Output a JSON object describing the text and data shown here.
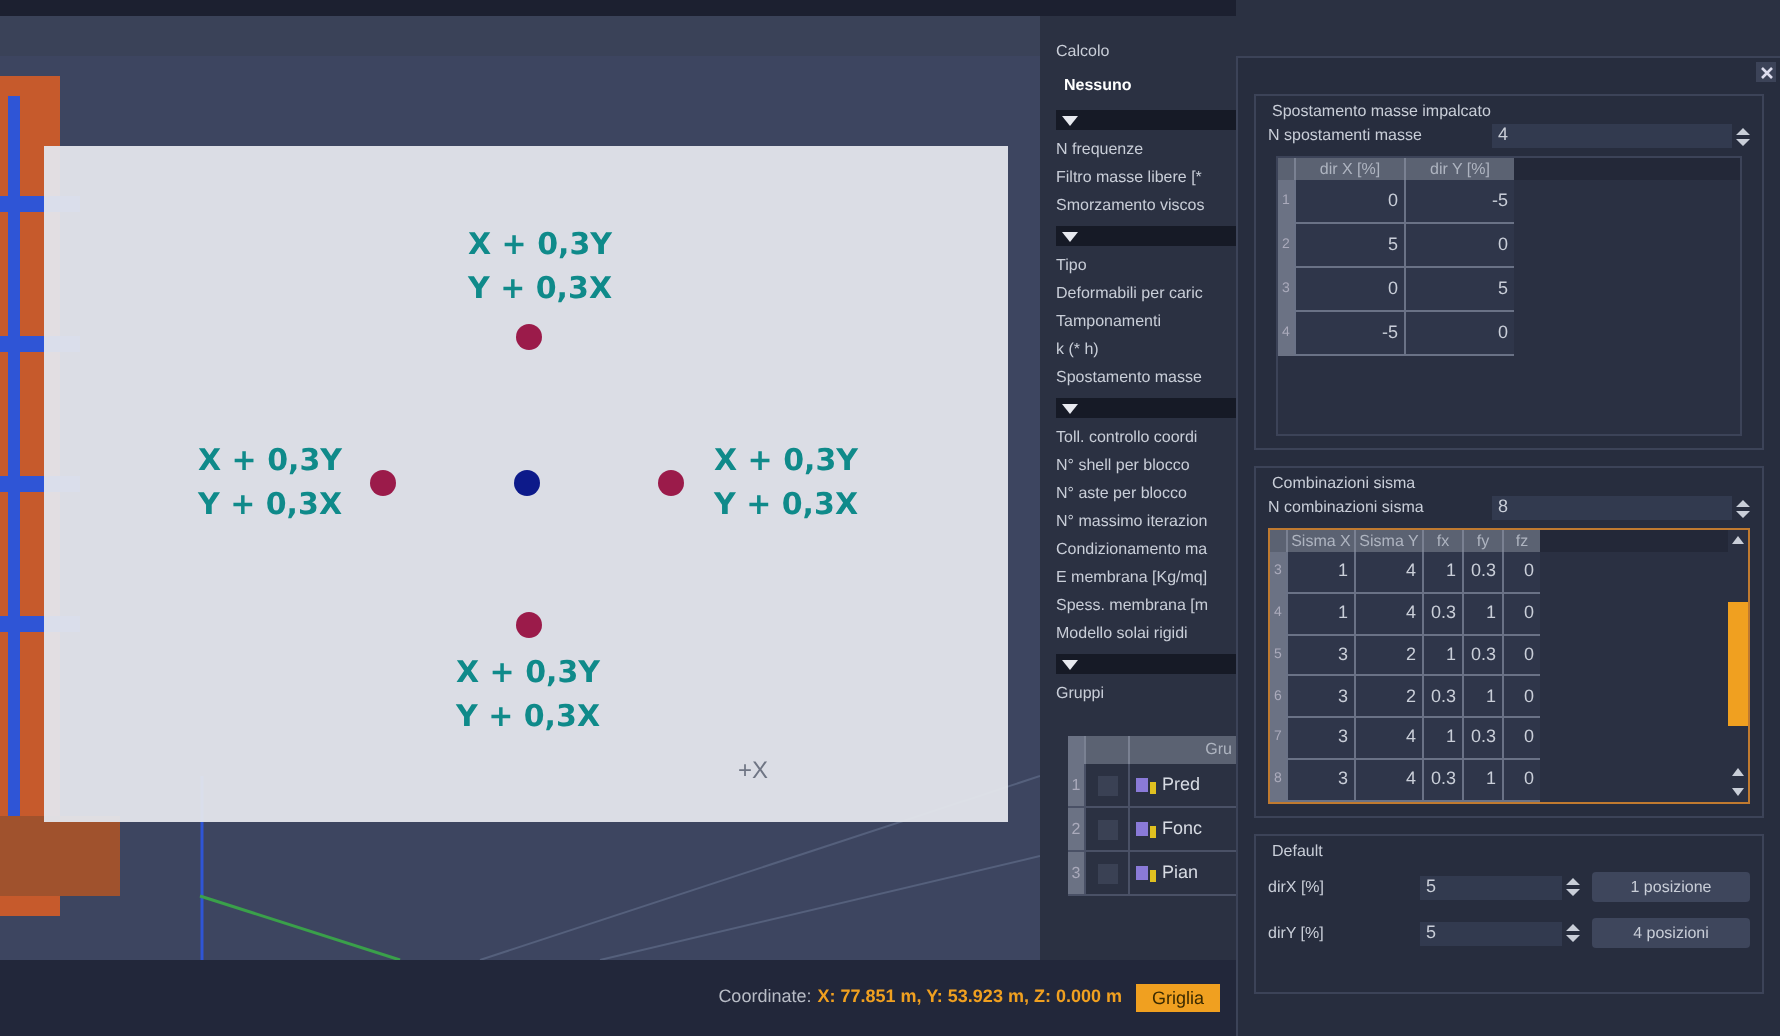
{
  "viewport": {
    "overlay": {
      "points": [
        {
          "color": "#9b1b4a",
          "label_lines": [
            "X + 0,3Y",
            "Y + 0,3X"
          ]
        },
        {
          "color": "#9b1b4a",
          "label_lines": [
            "X + 0,3Y",
            "Y + 0,3X"
          ]
        },
        {
          "color": "#0d1a8a"
        },
        {
          "color": "#9b1b4a",
          "label_lines": [
            "X + 0,3Y",
            "Y + 0,3X"
          ]
        },
        {
          "color": "#9b1b4a",
          "label_lines": [
            "X + 0,3Y",
            "Y + 0,3X"
          ]
        }
      ],
      "axis_label": "+X"
    }
  },
  "properties_panel": {
    "calcolo": {
      "label": "Calcolo",
      "value": "Nessuno"
    },
    "items": [
      {
        "kind": "section"
      },
      {
        "kind": "label",
        "text": "N frequenze"
      },
      {
        "kind": "label",
        "text": "Filtro masse libere [*"
      },
      {
        "kind": "label",
        "text": "Smorzamento viscos"
      },
      {
        "kind": "section"
      },
      {
        "kind": "label",
        "text": "Tipo"
      },
      {
        "kind": "label",
        "text": "Deformabili per caric"
      },
      {
        "kind": "label",
        "text": "Tamponamenti"
      },
      {
        "kind": "label",
        "text": "k (* h)"
      },
      {
        "kind": "label",
        "text": "Spostamento masse"
      },
      {
        "kind": "section"
      },
      {
        "kind": "label",
        "text": "Toll. controllo coordi"
      },
      {
        "kind": "label",
        "text": "N° shell per blocco"
      },
      {
        "kind": "label",
        "text": "N° aste per blocco"
      },
      {
        "kind": "label",
        "text": "N° massimo iterazion"
      },
      {
        "kind": "label",
        "text": "Condizionamento ma"
      },
      {
        "kind": "label",
        "text": "E membrana [Kg/mq]"
      },
      {
        "kind": "label",
        "text": "Spess. membrana [m"
      },
      {
        "kind": "label",
        "text": "Modello solai rigidi"
      },
      {
        "kind": "section"
      },
      {
        "kind": "label",
        "text": "Gruppi"
      }
    ],
    "groups_table": {
      "column_3": "Gru",
      "rows": [
        {
          "index": "1",
          "checked": false,
          "name": "Pred"
        },
        {
          "index": "2",
          "checked": false,
          "name": "Fonc"
        },
        {
          "index": "3",
          "checked": false,
          "name": "Pian"
        }
      ]
    }
  },
  "dialog": {
    "spostamento": {
      "title": "Spostamento masse impalcato",
      "count_label": "N spostamenti masse",
      "count_value": "4",
      "columns": [
        "dir X [%]",
        "dir Y [%]"
      ],
      "rows": [
        {
          "index": "1",
          "cells": [
            "0",
            "-5"
          ]
        },
        {
          "index": "2",
          "cells": [
            "5",
            "0"
          ]
        },
        {
          "index": "3",
          "cells": [
            "0",
            "5"
          ]
        },
        {
          "index": "4",
          "cells": [
            "-5",
            "0"
          ]
        }
      ]
    },
    "combinazioni": {
      "title": "Combinazioni sisma",
      "count_label": "N combinazioni sisma",
      "count_value": "8",
      "columns": [
        "Sisma X",
        "Sisma Y",
        "fx",
        "fy",
        "fz"
      ],
      "rows": [
        {
          "index": "3",
          "cells": [
            "1",
            "4",
            "1",
            "0.3",
            "0"
          ]
        },
        {
          "index": "4",
          "cells": [
            "1",
            "4",
            "0.3",
            "1",
            "0"
          ]
        },
        {
          "index": "5",
          "cells": [
            "3",
            "2",
            "1",
            "0.3",
            "0"
          ]
        },
        {
          "index": "6",
          "cells": [
            "3",
            "2",
            "0.3",
            "1",
            "0"
          ]
        },
        {
          "index": "7",
          "cells": [
            "3",
            "4",
            "1",
            "0.3",
            "0"
          ]
        },
        {
          "index": "8",
          "cells": [
            "3",
            "4",
            "0.3",
            "1",
            "0"
          ]
        }
      ]
    },
    "default": {
      "title": "Default",
      "fields": [
        {
          "label": "dirX [%]",
          "value": "5",
          "button": "1 posizione"
        },
        {
          "label": "dirY [%]",
          "value": "5",
          "button": "4 posizioni"
        }
      ]
    }
  },
  "status_bar": {
    "label": "Coordinate:",
    "coordinates": "X: 77.851 m, Y: 53.923 m, Z: 0.000 m",
    "grid_button": "Griglia"
  }
}
